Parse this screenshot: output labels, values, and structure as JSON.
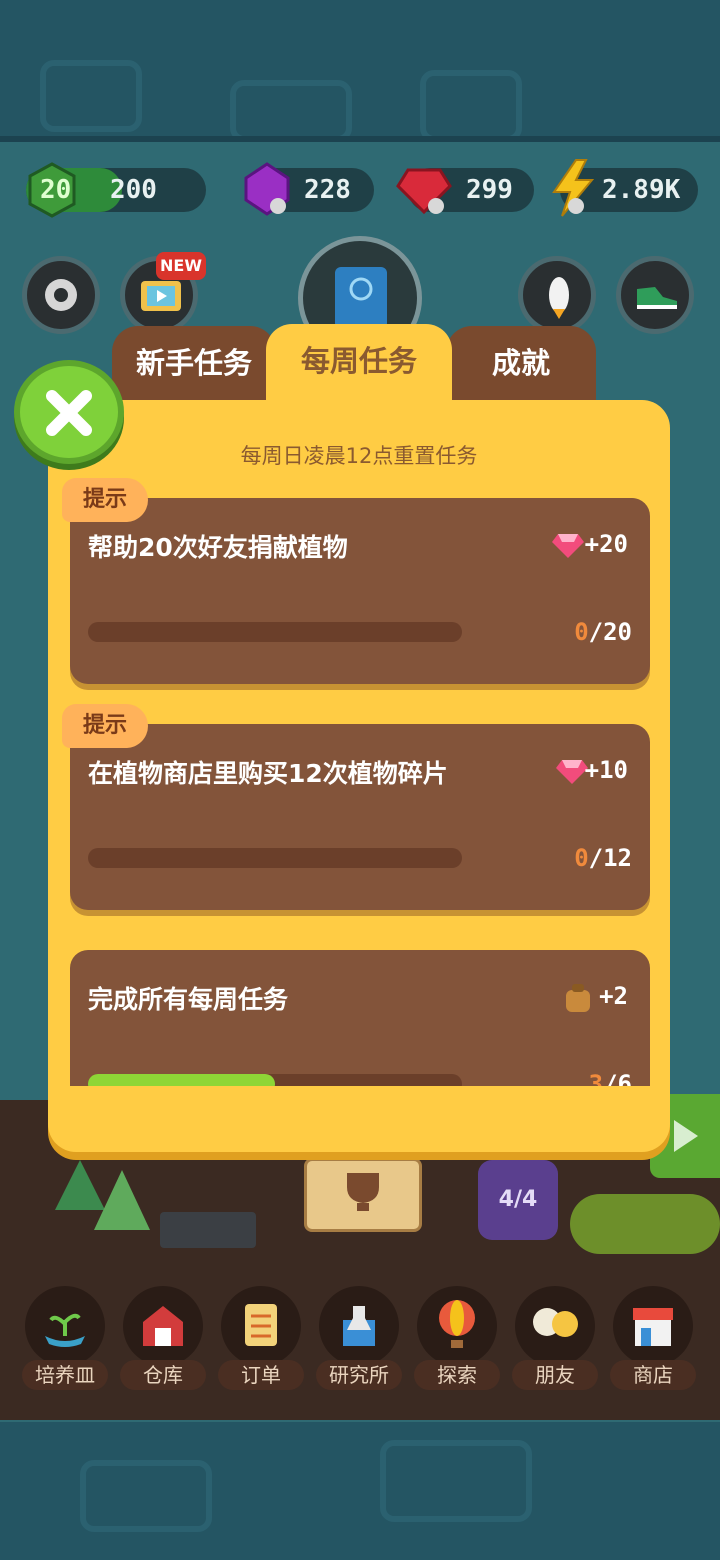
{
  "currencies": {
    "level": "20",
    "xp": "200",
    "gems_purple": "228",
    "gems_red": "299",
    "energy": "2.89K"
  },
  "badges": {
    "new": "NEW"
  },
  "tabs": [
    {
      "label": "新手任务"
    },
    {
      "label": "每周任务"
    },
    {
      "label": "成就"
    }
  ],
  "reset_note": "每周日凌晨12点重置任务",
  "tip_label": "提示",
  "tasks": [
    {
      "title": "帮助20次好友捐献植物",
      "reward": "+20",
      "current": "0",
      "total": "/20",
      "fraction": 0.0
    },
    {
      "title": "在植物商店里购买12次植物碎片",
      "reward": "+10",
      "current": "0",
      "total": "/12",
      "fraction": 0.0
    },
    {
      "title": "完成所有每周任务",
      "reward": "+2",
      "current": "3",
      "total": "/6",
      "fraction": 0.5
    }
  ],
  "scene": {
    "capacity": "4/4"
  },
  "nav": [
    {
      "label": "培养皿"
    },
    {
      "label": "仓库"
    },
    {
      "label": "订单"
    },
    {
      "label": "研究所"
    },
    {
      "label": "探索"
    },
    {
      "label": "朋友"
    },
    {
      "label": "商店"
    }
  ]
}
